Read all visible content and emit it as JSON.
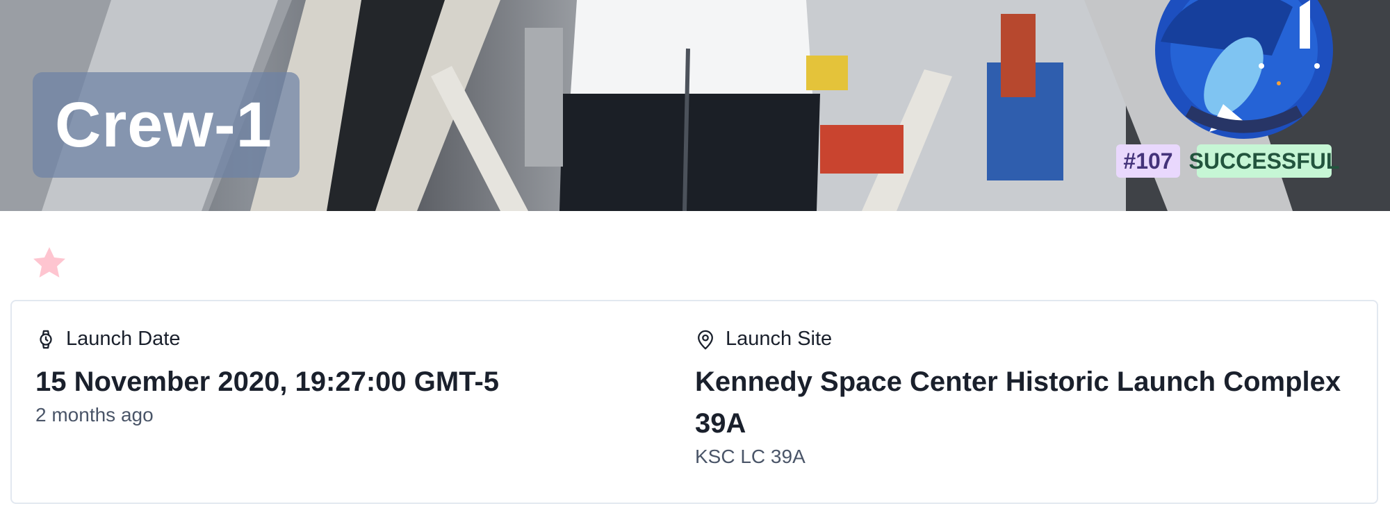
{
  "launch": {
    "name": "Crew-1",
    "flight_number_badge": "#107",
    "status_badge": "SUCCESSFUL",
    "favorite": false
  },
  "details": {
    "date": {
      "icon": "watch-icon",
      "label": "Launch Date",
      "value": "15 November 2020, 19:27:00 GMT-5",
      "relative": "2 months ago"
    },
    "site": {
      "icon": "map-pin-icon",
      "label": "Launch Site",
      "value": "Kennedy Space Center Historic Launch Complex 39A",
      "short": "KSC LC 39A"
    }
  },
  "colors": {
    "favorite_star": "#fec5d0",
    "flight_badge_bg": "#e9d8fd",
    "flight_badge_text": "#44337a",
    "status_badge_bg": "#c6f6d5",
    "status_badge_text": "#22543d",
    "title_overlay": "#6e82a5"
  }
}
